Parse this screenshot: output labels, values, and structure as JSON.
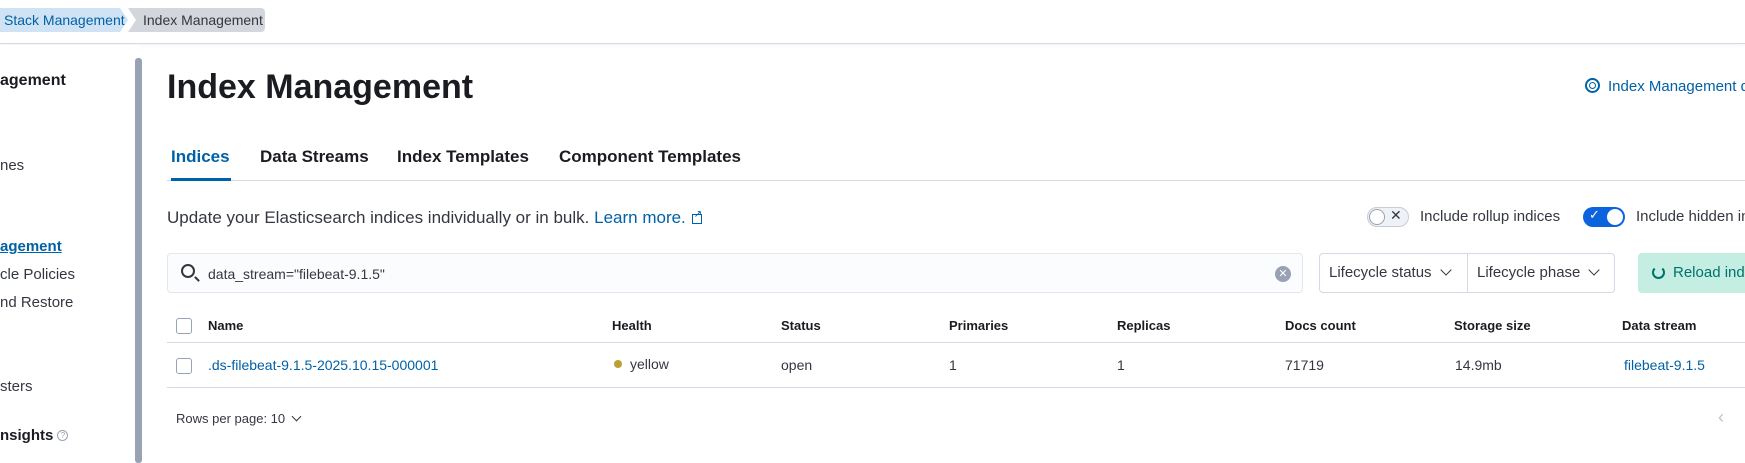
{
  "breadcrumbs": [
    "Stack Management",
    "Index Management"
  ],
  "sidebar": {
    "heading": "agement",
    "items": [
      {
        "label": "nes",
        "active": false
      },
      {
        "label": "agement",
        "active": true
      },
      {
        "label": "cle Policies",
        "active": false
      },
      {
        "label": "nd Restore",
        "active": false
      },
      {
        "label": "sters",
        "active": false
      }
    ],
    "sub_heading": "nsights"
  },
  "page": {
    "title": "Index Management",
    "docs_link": "Index Management d"
  },
  "tabs": [
    "Indices",
    "Data Streams",
    "Index Templates",
    "Component Templates"
  ],
  "description": {
    "text": "Update your Elasticsearch indices individually or in bulk.",
    "link": "Learn more."
  },
  "toggles": {
    "rollup": {
      "label": "Include rollup indices",
      "on": false
    },
    "hidden": {
      "label": "Include hidden in",
      "on": true
    }
  },
  "search": {
    "value": "data_stream=\"filebeat-9.1.5\""
  },
  "filters": {
    "lifecycle_status": "Lifecycle status",
    "lifecycle_phase": "Lifecycle phase"
  },
  "reload_button": "Reload ind",
  "table": {
    "columns": [
      "Name",
      "Health",
      "Status",
      "Primaries",
      "Replicas",
      "Docs count",
      "Storage size",
      "Data stream"
    ],
    "rows": [
      {
        "name": ".ds-filebeat-9.1.5-2025.10.15-000001",
        "health": "yellow",
        "status": "open",
        "primaries": "1",
        "replicas": "1",
        "docs_count": "71719",
        "storage_size": "14.9mb",
        "data_stream": "filebeat-9.1.5"
      }
    ]
  },
  "pagination": {
    "rows_per_page": "Rows per page: 10"
  },
  "colors": {
    "accent": "#0061a6",
    "health_yellow": "#b9a135",
    "reload_bg": "#c5eee3"
  }
}
